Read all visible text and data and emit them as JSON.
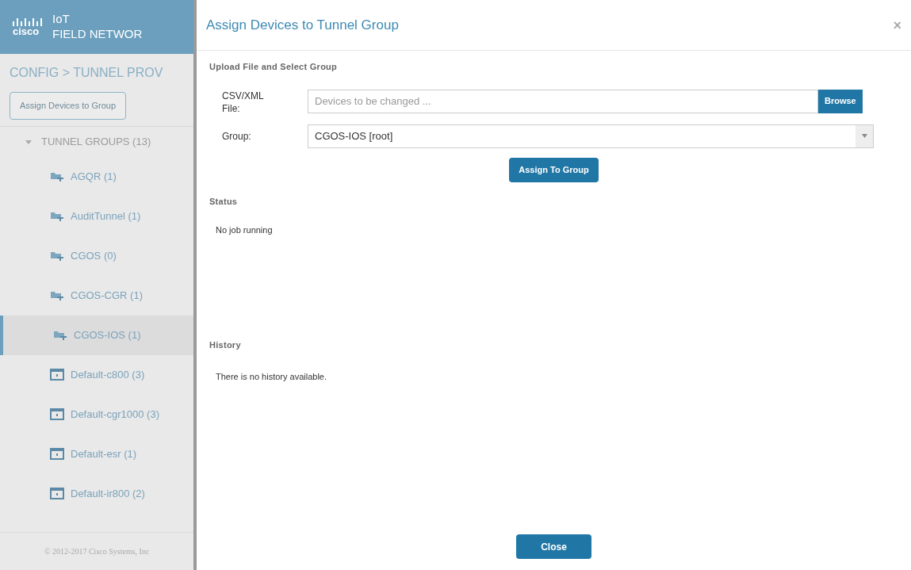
{
  "header": {
    "logo_text": "cisco",
    "product_line1": "IoT",
    "product_line2": "FIELD NETWOR"
  },
  "breadcrumb": "CONFIG > TUNNEL PROV",
  "assign_button": "Assign Devices to Group",
  "tree": {
    "label": "TUNNEL GROUPS (13)",
    "expanded": true,
    "children": [
      {
        "label": "AGQR (1)",
        "kind": "tunnel",
        "selected": false
      },
      {
        "label": "AuditTunnel (1)",
        "kind": "tunnel",
        "selected": false
      },
      {
        "label": "CGOS (0)",
        "kind": "tunnel",
        "selected": false
      },
      {
        "label": "CGOS-CGR (1)",
        "kind": "tunnel",
        "selected": false
      },
      {
        "label": "CGOS-IOS (1)",
        "kind": "tunnel",
        "selected": true
      },
      {
        "label": "Default-c800 (3)",
        "kind": "default",
        "selected": false
      },
      {
        "label": "Default-cgr1000 (3)",
        "kind": "default",
        "selected": false
      },
      {
        "label": "Default-esr (1)",
        "kind": "default",
        "selected": false
      },
      {
        "label": "Default-ir800 (2)",
        "kind": "default",
        "selected": false
      }
    ]
  },
  "footer": "© 2012-2017 Cisco Systems, Inc",
  "dialog": {
    "title": "Assign Devices to Tunnel Group",
    "close_icon": "×",
    "upload_section": "Upload File and Select Group",
    "file_label": "CSV/XML File:",
    "file_placeholder": "Devices to be changed ...",
    "browse_button": "Browse",
    "group_label": "Group:",
    "group_value": "CGOS-IOS [root]",
    "assign_button": "Assign To Group",
    "status_section": "Status",
    "status_text": "No job running",
    "history_section": "History",
    "history_text": "There is no history available.",
    "close_button": "Close"
  }
}
